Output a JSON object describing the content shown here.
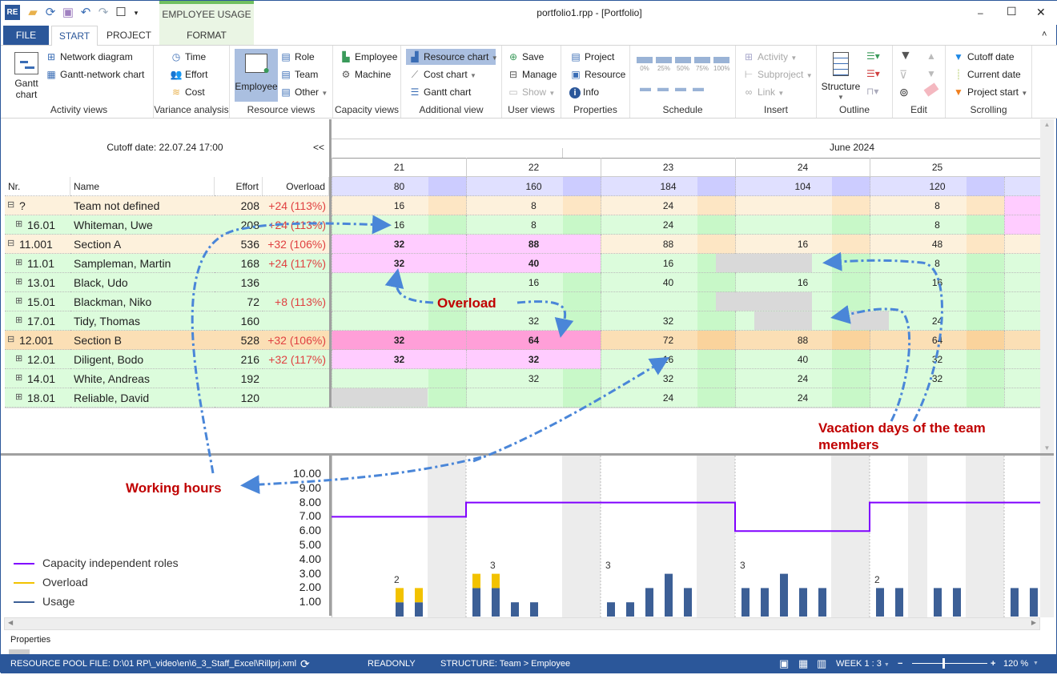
{
  "window": {
    "title": "portfolio1.rpp - [Portfolio]",
    "context_tab": "EMPLOYEE USAGE",
    "minimize": "‒",
    "maximize": "☐",
    "close": "✕",
    "collapse": "˄"
  },
  "tabs": [
    {
      "label": "FILE"
    },
    {
      "label": "START"
    },
    {
      "label": "PROJECT"
    },
    {
      "label": "FORMAT"
    }
  ],
  "ribbon": {
    "activity_views": {
      "label": "Activity views",
      "gantt": "Gantt chart",
      "network": "Network diagram",
      "gantt_network": "Gantt-network chart"
    },
    "variance": {
      "label": "Variance analysis",
      "time": "Time",
      "effort": "Effort",
      "cost": "Cost"
    },
    "resource_views": {
      "label": "Resource views",
      "employee": "Employee",
      "role": "Role",
      "team": "Team",
      "other": "Other"
    },
    "capacity_views": {
      "label": "Capacity views",
      "employee": "Employee",
      "machine": "Machine"
    },
    "additional": {
      "label": "Additional view",
      "resource_chart": "Resource chart",
      "cost_chart": "Cost chart",
      "gantt_chart": "Gantt chart"
    },
    "user_views": {
      "label": "User views",
      "save": "Save",
      "manage": "Manage",
      "show": "Show"
    },
    "properties": {
      "label": "Properties",
      "project": "Project",
      "resource": "Resource",
      "info": "Info"
    },
    "schedule": {
      "label": "Schedule",
      "levels": [
        "0%",
        "25%",
        "50%",
        "75%",
        "100%"
      ]
    },
    "insert": {
      "label": "Insert",
      "activity": "Activity",
      "subproject": "Subproject",
      "link": "Link"
    },
    "outline": {
      "label": "Outline",
      "structure": "Structure"
    },
    "edit": {
      "label": "Edit"
    },
    "scrolling": {
      "label": "Scrolling",
      "cutoff": "Cutoff date",
      "current": "Current date",
      "project_start": "Project start"
    }
  },
  "table": {
    "cutoff": "Cutoff date: 22.07.24 17:00",
    "collapse": "<<",
    "columns": {
      "nr": "Nr.",
      "name": "Name",
      "effort": "Effort",
      "overload": "Overload"
    },
    "rows": [
      {
        "nr": "? ",
        "name": "Team not defined",
        "effort": "208",
        "overload": "+24 (113%)",
        "type": "team"
      },
      {
        "nr": "16.01",
        "name": "Whiteman, Uwe",
        "effort": "208",
        "overload": "+24 (113%)",
        "type": "emp"
      },
      {
        "nr": "11.001",
        "name": "Section A",
        "effort": "536",
        "overload": "+32 (106%)",
        "type": "team"
      },
      {
        "nr": "11.01",
        "name": "Sampleman, Martin",
        "effort": "168",
        "overload": "+24 (117%)",
        "type": "emp"
      },
      {
        "nr": "13.01",
        "name": "Black, Udo",
        "effort": "136",
        "overload": "",
        "type": "emp"
      },
      {
        "nr": "15.01",
        "name": "Blackman, Niko",
        "effort": "72",
        "overload": "+8 (113%)",
        "type": "emp"
      },
      {
        "nr": "17.01",
        "name": "Tidy, Thomas",
        "effort": "160",
        "overload": "",
        "type": "emp"
      },
      {
        "nr": "12.001",
        "name": "Section B",
        "effort": "528",
        "overload": "+32 (106%)",
        "type": "team2"
      },
      {
        "nr": "12.01",
        "name": "Diligent, Bodo",
        "effort": "216",
        "overload": "+32 (117%)",
        "type": "emp"
      },
      {
        "nr": "14.01",
        "name": "White, Andreas",
        "effort": "192",
        "overload": "",
        "type": "emp"
      },
      {
        "nr": "18.01",
        "name": "Reliable, David",
        "effort": "120",
        "overload": "",
        "type": "emp"
      }
    ]
  },
  "timeline": {
    "month": "June 2024",
    "weeks": [
      "21",
      "22",
      "23",
      "24",
      "25"
    ],
    "totals": [
      "80",
      "160",
      "184",
      "104",
      "120"
    ],
    "values": [
      [
        "16",
        "8",
        "24",
        "",
        "8"
      ],
      [
        "16",
        "8",
        "24",
        "",
        "8"
      ],
      [
        "32",
        "88",
        "88",
        "16",
        "48"
      ],
      [
        "32",
        "40",
        "16",
        "",
        "8"
      ],
      [
        "",
        "16",
        "40",
        "16",
        "16"
      ],
      [
        "",
        "",
        "",
        "",
        ""
      ],
      [
        "",
        "32",
        "32",
        "",
        "24"
      ],
      [
        "32",
        "64",
        "72",
        "88",
        "64"
      ],
      [
        "32",
        "32",
        "16",
        "40",
        "32"
      ],
      [
        "",
        "32",
        "32",
        "24",
        "32"
      ],
      [
        "",
        "",
        "24",
        "24",
        ""
      ]
    ],
    "overloaded_weeks": {
      "2": [
        0,
        1
      ],
      "3": [
        0,
        1
      ],
      "7": [
        0,
        1
      ],
      "8": [
        0,
        1
      ]
    },
    "vacation_days": [
      {
        "row": 3,
        "from_day": 21,
        "to_day": 25
      },
      {
        "row": 5,
        "from_day": 21,
        "to_day": 25
      },
      {
        "row": 6,
        "from_day": 23,
        "to_day": 25
      },
      {
        "row": 6,
        "from_day": 28,
        "to_day": 29
      },
      {
        "row": 10,
        "from_day": 1,
        "to_day": 5
      }
    ]
  },
  "chart_data": {
    "type": "bar",
    "ylim": [
      0,
      10
    ],
    "yticks": [
      "10.00",
      "9.00",
      "8.00",
      "7.00",
      "6.00",
      "5.00",
      "4.00",
      "3.00",
      "2.00",
      "1.00"
    ],
    "legend": [
      {
        "name": "Capacity independent roles",
        "color": "#8000ff"
      },
      {
        "name": "Overload",
        "color": "#f2c200"
      },
      {
        "name": "Usage",
        "color": "#3c5f96"
      }
    ],
    "capacity_by_week": [
      7,
      8,
      8,
      6,
      8,
      8
    ],
    "days": [
      {
        "day": 3,
        "usage": 1,
        "overload": 1
      },
      {
        "day": 4,
        "usage": 1,
        "overload": 1
      },
      {
        "day": 7,
        "usage": 2,
        "overload": 1
      },
      {
        "day": 8,
        "usage": 2,
        "overload": 1
      },
      {
        "day": 9,
        "usage": 1,
        "overload": 0
      },
      {
        "day": 10,
        "usage": 1,
        "overload": 0
      },
      {
        "day": 14,
        "usage": 1,
        "overload": 0
      },
      {
        "day": 15,
        "usage": 1,
        "overload": 0
      },
      {
        "day": 16,
        "usage": 2,
        "overload": 0
      },
      {
        "day": 17,
        "usage": 3,
        "overload": 0
      },
      {
        "day": 18,
        "usage": 2,
        "overload": 0
      },
      {
        "day": 21,
        "usage": 2,
        "overload": 0
      },
      {
        "day": 22,
        "usage": 2,
        "overload": 0
      },
      {
        "day": 23,
        "usage": 3,
        "overload": 0
      },
      {
        "day": 24,
        "usage": 2,
        "overload": 0
      },
      {
        "day": 25,
        "usage": 2,
        "overload": 0
      },
      {
        "day": 28,
        "usage": 2,
        "overload": 0
      },
      {
        "day": 29,
        "usage": 2,
        "overload": 0
      },
      {
        "day": 31,
        "usage": 2,
        "overload": 0
      },
      {
        "day": 32,
        "usage": 2,
        "overload": 0
      },
      {
        "day": 35,
        "usage": 2,
        "overload": 0
      },
      {
        "day": 36,
        "usage": 2,
        "overload": 0
      }
    ],
    "week_counts": [
      "2",
      "3",
      "3",
      "3",
      "2"
    ],
    "nonworking_days": [
      5,
      6,
      12,
      13,
      19,
      20,
      26,
      27,
      30,
      33,
      34
    ]
  },
  "annotations": {
    "overload": "Overload",
    "working_hours": "Working hours",
    "vacation": "Vacation days of the team members"
  },
  "panel": {
    "properties": "Properties"
  },
  "status": {
    "file": "RESOURCE POOL FILE: D:\\01 RP\\_video\\en\\6_3_Staff_Excel\\Rillprj.xml",
    "readonly": "READONLY",
    "structure": "STRUCTURE: Team > Employee",
    "scale": "WEEK 1 : 3",
    "zoom": "120 %",
    "zoom_level_percent": 120
  }
}
